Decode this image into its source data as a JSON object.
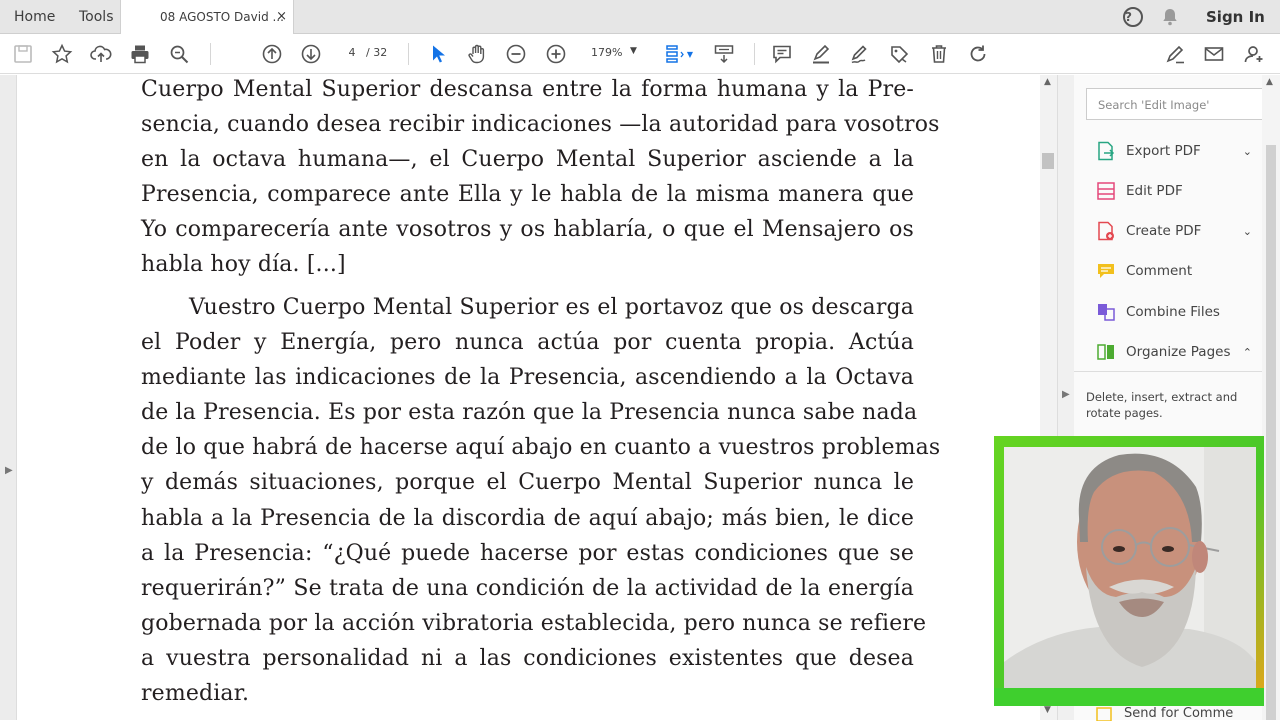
{
  "tabs": {
    "home": "Home",
    "tools": "Tools",
    "document": "08 AGOSTO David ...",
    "close_glyph": "×"
  },
  "header": {
    "help_glyph": "?",
    "sign_in": "Sign In"
  },
  "toolbar": {
    "page_current": "4",
    "page_total": "/ 32",
    "zoom": "179%"
  },
  "document": {
    "paragraph1": [
      "Cuerpo Mental Superior descansa entre la forma humana y la Pre-",
      "sencia, cuando desea recibir indicaciones —la autoridad para vosotros",
      "en la octava humana—, el Cuerpo Mental Superior asciende a la",
      "Presencia, comparece ante Ella y le habla de la misma manera que",
      "Yo comparecería ante vosotros y os hablaría, o que el Mensajero os",
      "habla hoy día. [...]"
    ],
    "paragraph2": [
      "Vuestro Cuerpo Mental Superior es el portavoz que os descarga",
      "el Poder y Energía, pero nunca actúa por cuenta propia. Actúa",
      "mediante las indicaciones de la Presencia, ascendiendo a la Octava",
      "de la Presencia. Es por esta razón que la Presencia nunca sabe nada",
      "de lo que habrá de hacerse aquí abajo en cuanto a vuestros problemas",
      "y demás situaciones, porque el Cuerpo Mental Superior nunca le",
      "habla a la Presencia de la discordia de aquí abajo; más bien, le dice",
      "a la Presencia: “¿Qué puede hacerse por estas condiciones que se",
      "requerirán?” Se trata de una condición de la actividad de la energía",
      "gobernada por la acción vibratoria establecida, pero nunca se refiere",
      "a vuestra personalidad ni a las condiciones existentes que desea",
      "remediar."
    ]
  },
  "right_panel": {
    "search_placeholder": "Search 'Edit Image'",
    "items": [
      {
        "label": "Export PDF",
        "icon": "export-pdf-icon",
        "chevron": "⌄",
        "color": "#27a582"
      },
      {
        "label": "Edit PDF",
        "icon": "edit-pdf-icon",
        "chevron": "",
        "color": "#e4477b"
      },
      {
        "label": "Create PDF",
        "icon": "create-pdf-icon",
        "chevron": "⌄",
        "color": "#e34850"
      },
      {
        "label": "Comment",
        "icon": "comment-icon",
        "chevron": "",
        "color": "#f2c01d"
      },
      {
        "label": "Combine Files",
        "icon": "combine-files-icon",
        "chevron": "",
        "color": "#7a5ad8"
      },
      {
        "label": "Organize Pages",
        "icon": "organize-pages-icon",
        "chevron": "⌃",
        "color": "#4cab31"
      }
    ],
    "description": "Delete, insert, extract and rotate pages.",
    "partial_item": "Send for Comme"
  },
  "webcam": {
    "frame_color": "#52cc26",
    "accent_color": "#e7a51b"
  }
}
